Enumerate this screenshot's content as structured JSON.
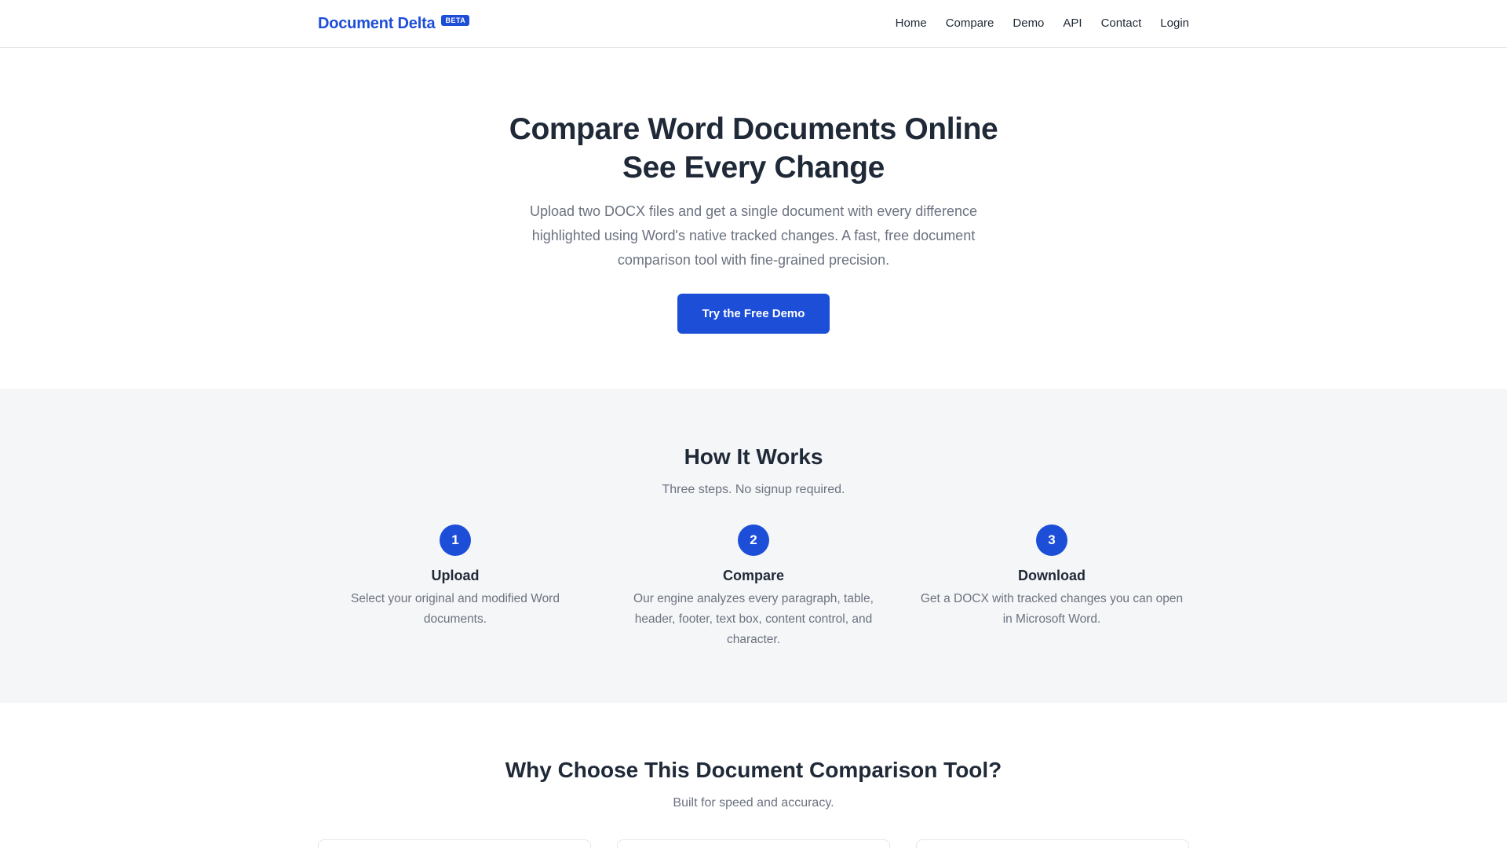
{
  "header": {
    "brand": "Document Delta",
    "badge": "BETA",
    "nav": [
      "Home",
      "Compare",
      "Demo",
      "API",
      "Contact",
      "Login"
    ]
  },
  "hero": {
    "title_line1": "Compare Word Documents Online",
    "title_line2": "See Every Change",
    "subtitle": "Upload two DOCX files and get a single document with every difference highlighted using Word's native tracked changes. A fast, free document comparison tool with fine-grained precision.",
    "cta_label": "Try the Free Demo"
  },
  "how": {
    "title": "How It Works",
    "subtitle": "Three steps. No signup required.",
    "steps": [
      {
        "number": "1",
        "title": "Upload",
        "description": "Select your original and modified Word documents."
      },
      {
        "number": "2",
        "title": "Compare",
        "description": "Our engine analyzes every paragraph, table, header, footer, text box, content control, and character."
      },
      {
        "number": "3",
        "title": "Download",
        "description": "Get a DOCX with tracked changes you can open in Microsoft Word."
      }
    ]
  },
  "why": {
    "title": "Why Choose This Document Comparison Tool?",
    "subtitle": "Built for speed and accuracy."
  },
  "colors": {
    "accent": "#1d4ed8",
    "text": "#1f2937",
    "muted": "#6b7280",
    "section_bg": "#f5f6f7"
  }
}
